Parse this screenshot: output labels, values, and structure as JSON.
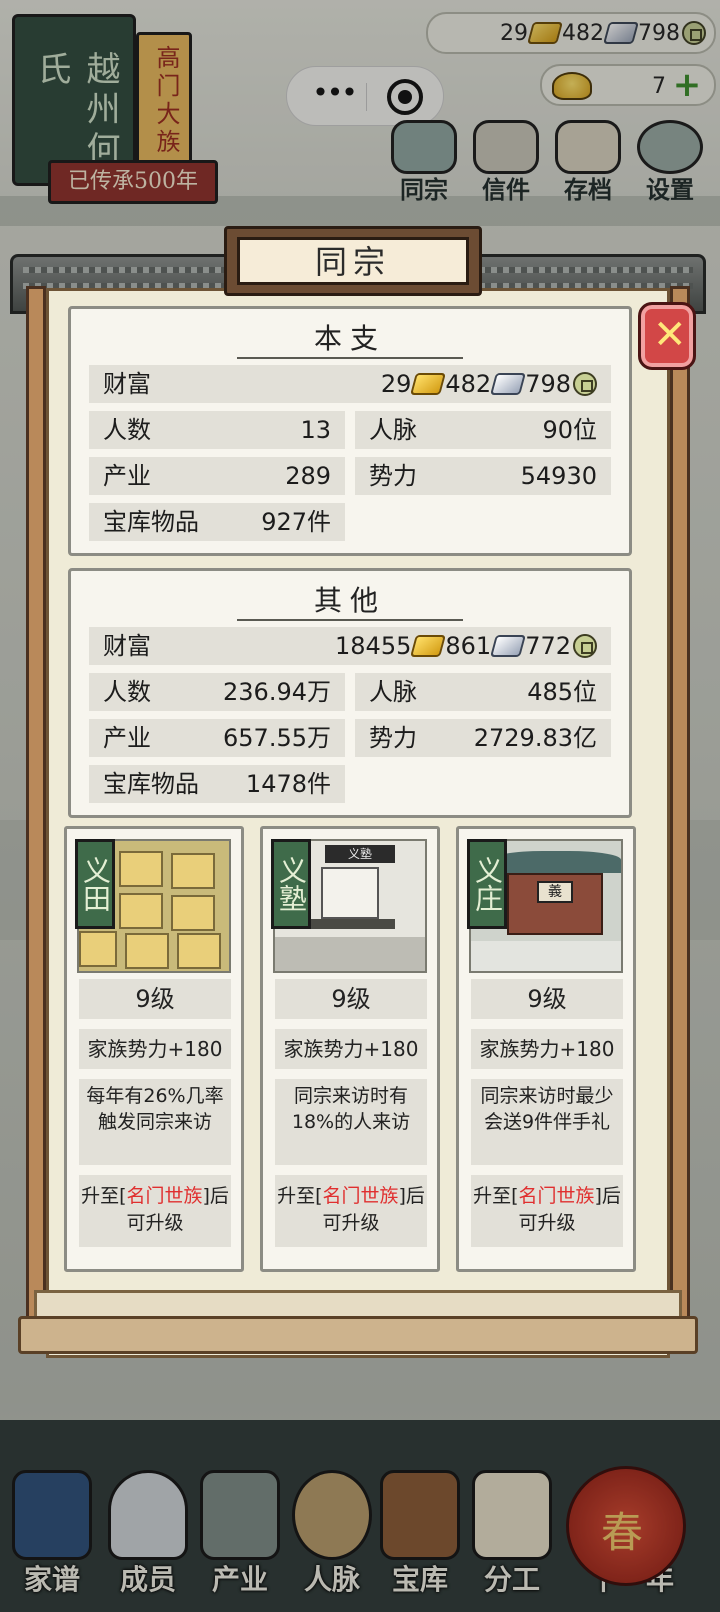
{
  "clan_plaque": {
    "book_text": "越州何氏",
    "rank_text": "高门大族",
    "ribbon": "已传承500年"
  },
  "currency": {
    "gold": "29",
    "silver": "482",
    "copper": "798",
    "ingot": "7"
  },
  "top_menu": [
    {
      "label": "同宗",
      "icon": "clan-icon"
    },
    {
      "label": "信件",
      "icon": "letter-icon"
    },
    {
      "label": "存档",
      "icon": "save-icon"
    },
    {
      "label": "设置",
      "icon": "settings-gear-icon"
    }
  ],
  "modal": {
    "title": "同宗",
    "main_branch": {
      "heading": "本支",
      "wealth_label": "财富",
      "wealth": {
        "gold": "29",
        "silver": "482",
        "copper": "798"
      },
      "people_label": "人数",
      "people": "13",
      "network_label": "人脉",
      "network": "90位",
      "property_label": "产业",
      "property": "289",
      "power_label": "势力",
      "power": "54930",
      "treasury_label": "宝库物品",
      "treasury": "927件"
    },
    "others": {
      "heading": "其他",
      "wealth_label": "财富",
      "wealth": {
        "gold": "18455",
        "silver": "861",
        "copper": "772"
      },
      "people_label": "人数",
      "people": "236.94万",
      "network_label": "人脉",
      "network": "485位",
      "property_label": "产业",
      "property": "657.55万",
      "power_label": "势力",
      "power": "2729.83亿",
      "treasury_label": "宝库物品",
      "treasury": "1478件"
    },
    "buildings": [
      {
        "name": "义田",
        "level": "9级",
        "power": "家族势力+180",
        "desc": "每年有26%几率触发同宗来访",
        "upgrade_pre": "升至[",
        "upgrade_rank": "名门世族",
        "upgrade_post": "]后可升级"
      },
      {
        "name": "义塾",
        "level": "9级",
        "power": "家族势力+180",
        "desc": "同宗来访时有18%的人来访",
        "upgrade_pre": "升至[",
        "upgrade_rank": "名门世族",
        "upgrade_post": "]后可升级",
        "sign": "义塾"
      },
      {
        "name": "义庄",
        "level": "9级",
        "power": "家族势力+180",
        "desc": "同宗来访时最少会送9件伴手礼",
        "upgrade_pre": "升至[",
        "upgrade_rank": "名门世族",
        "upgrade_post": "]后可升级",
        "sign": "義"
      }
    ]
  },
  "bottom_nav": [
    {
      "label": "家谱",
      "icon": "genealogy-book-icon"
    },
    {
      "label": "成员",
      "icon": "member-portrait-icon"
    },
    {
      "label": "产业",
      "icon": "property-building-icon"
    },
    {
      "label": "人脉",
      "icon": "network-icon"
    },
    {
      "label": "宝库",
      "icon": "treasury-chest-icon"
    },
    {
      "label": "分工",
      "icon": "scroll-icon"
    },
    {
      "label": "下一年",
      "icon": "lantern-icon"
    }
  ],
  "lantern_char": "春",
  "colors": {
    "accent_red": "#e02f2f",
    "tag_green": "#3f6b4a",
    "close_red": "#d24747",
    "frame_wood": "#b9895a"
  }
}
